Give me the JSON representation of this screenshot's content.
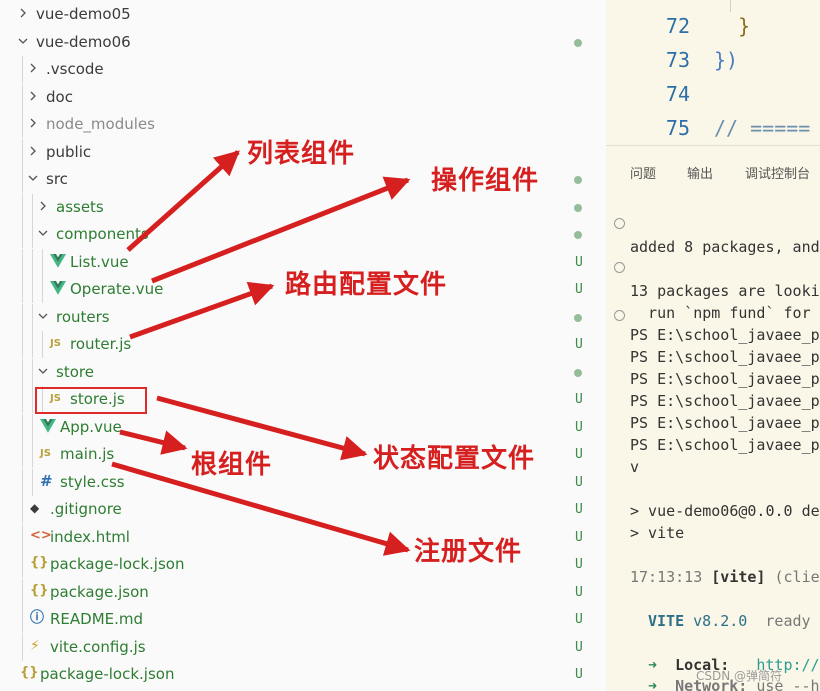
{
  "explorer": {
    "items": [
      {
        "label": "vue-demo05",
        "depth": 0,
        "kind": "folder-collapsed",
        "color": "normal",
        "badge": ""
      },
      {
        "label": "vue-demo06",
        "depth": 0,
        "kind": "folder-expanded",
        "color": "normal",
        "badge": "dot"
      },
      {
        "label": ".vscode",
        "depth": 1,
        "kind": "folder-collapsed",
        "color": "normal",
        "badge": ""
      },
      {
        "label": "doc",
        "depth": 1,
        "kind": "folder-collapsed",
        "color": "normal",
        "badge": ""
      },
      {
        "label": "node_modules",
        "depth": 1,
        "kind": "folder-collapsed",
        "color": "gray",
        "badge": ""
      },
      {
        "label": "public",
        "depth": 1,
        "kind": "folder-collapsed",
        "color": "normal",
        "badge": ""
      },
      {
        "label": "src",
        "depth": 1,
        "kind": "folder-expanded",
        "color": "normal",
        "badge": "dot"
      },
      {
        "label": "assets",
        "depth": 2,
        "kind": "folder-collapsed",
        "color": "green",
        "badge": "dot"
      },
      {
        "label": "components",
        "depth": 2,
        "kind": "folder-expanded",
        "color": "green",
        "badge": "dot"
      },
      {
        "label": "List.vue",
        "depth": 3,
        "kind": "vue",
        "color": "green",
        "badge": "U"
      },
      {
        "label": "Operate.vue",
        "depth": 3,
        "kind": "vue",
        "color": "green",
        "badge": "U"
      },
      {
        "label": "routers",
        "depth": 2,
        "kind": "folder-expanded",
        "color": "green",
        "badge": "dot"
      },
      {
        "label": "router.js",
        "depth": 3,
        "kind": "js",
        "color": "green",
        "badge": "U"
      },
      {
        "label": "store",
        "depth": 2,
        "kind": "folder-expanded",
        "color": "green",
        "badge": "dot"
      },
      {
        "label": "store.js",
        "depth": 3,
        "kind": "js",
        "color": "green",
        "badge": "U"
      },
      {
        "label": "App.vue",
        "depth": 2,
        "kind": "vue",
        "color": "green",
        "badge": "U"
      },
      {
        "label": "main.js",
        "depth": 2,
        "kind": "js",
        "color": "green",
        "badge": "U"
      },
      {
        "label": "style.css",
        "depth": 2,
        "kind": "css",
        "color": "green",
        "badge": "U"
      },
      {
        "label": ".gitignore",
        "depth": 1,
        "kind": "git",
        "color": "green",
        "badge": "U"
      },
      {
        "label": "index.html",
        "depth": 1,
        "kind": "html",
        "color": "green",
        "badge": "U"
      },
      {
        "label": "package-lock.json",
        "depth": 1,
        "kind": "json",
        "color": "green",
        "badge": "U"
      },
      {
        "label": "package.json",
        "depth": 1,
        "kind": "json",
        "color": "green",
        "badge": "U"
      },
      {
        "label": "README.md",
        "depth": 1,
        "kind": "info",
        "color": "green",
        "badge": "U"
      },
      {
        "label": "vite.config.js",
        "depth": 1,
        "kind": "vite",
        "color": "green",
        "badge": "U"
      },
      {
        "label": "package-lock.json",
        "depth": 0,
        "kind": "json",
        "color": "green",
        "badge": "U"
      }
    ]
  },
  "editor": {
    "lines": [
      {
        "num": "72",
        "code": "  }",
        "comment": false
      },
      {
        "num": "73",
        "code": "})",
        "comment": false
      },
      {
        "num": "74",
        "code": "",
        "comment": false
      },
      {
        "num": "75",
        "code": "// =====",
        "comment": true
      }
    ]
  },
  "panel": {
    "tabs": [
      "问题",
      "输出",
      "调试控制台"
    ],
    "terminal": {
      "added": "added 8 packages, and",
      "looking": "13 packages are looki",
      "fund": "  run `npm fund` for",
      "ps_lines": [
        "PS E:\\school_javaee_p",
        "PS E:\\school_javaee_p",
        "PS E:\\school_javaee_p",
        "PS E:\\school_javaee_p",
        "PS E:\\school_javaee_p",
        "PS E:\\school_javaee_p"
      ],
      "v": "v",
      "script_name": "> vue-demo06@0.0.0 de",
      "script_cmd": "> vite",
      "time": "17:13:13",
      "vite_tag": "[vite]",
      "client": "(clie",
      "vite_name": "VITE",
      "vite_version": "v8.2.0",
      "ready": "ready",
      "local_arrow": "➜",
      "local_label": "Local:",
      "local_url": "http://",
      "network_label": "Network:",
      "network_value": "use --h"
    },
    "watermark": "CSDN @弹简符"
  },
  "annotations": {
    "list_component": "列表组件",
    "operate_component": "操作组件",
    "router_config": "路由配置文件",
    "root_component": "根组件",
    "state_config": "状态配置文件",
    "register_file": "注册文件",
    "color": "#d61f1f"
  }
}
